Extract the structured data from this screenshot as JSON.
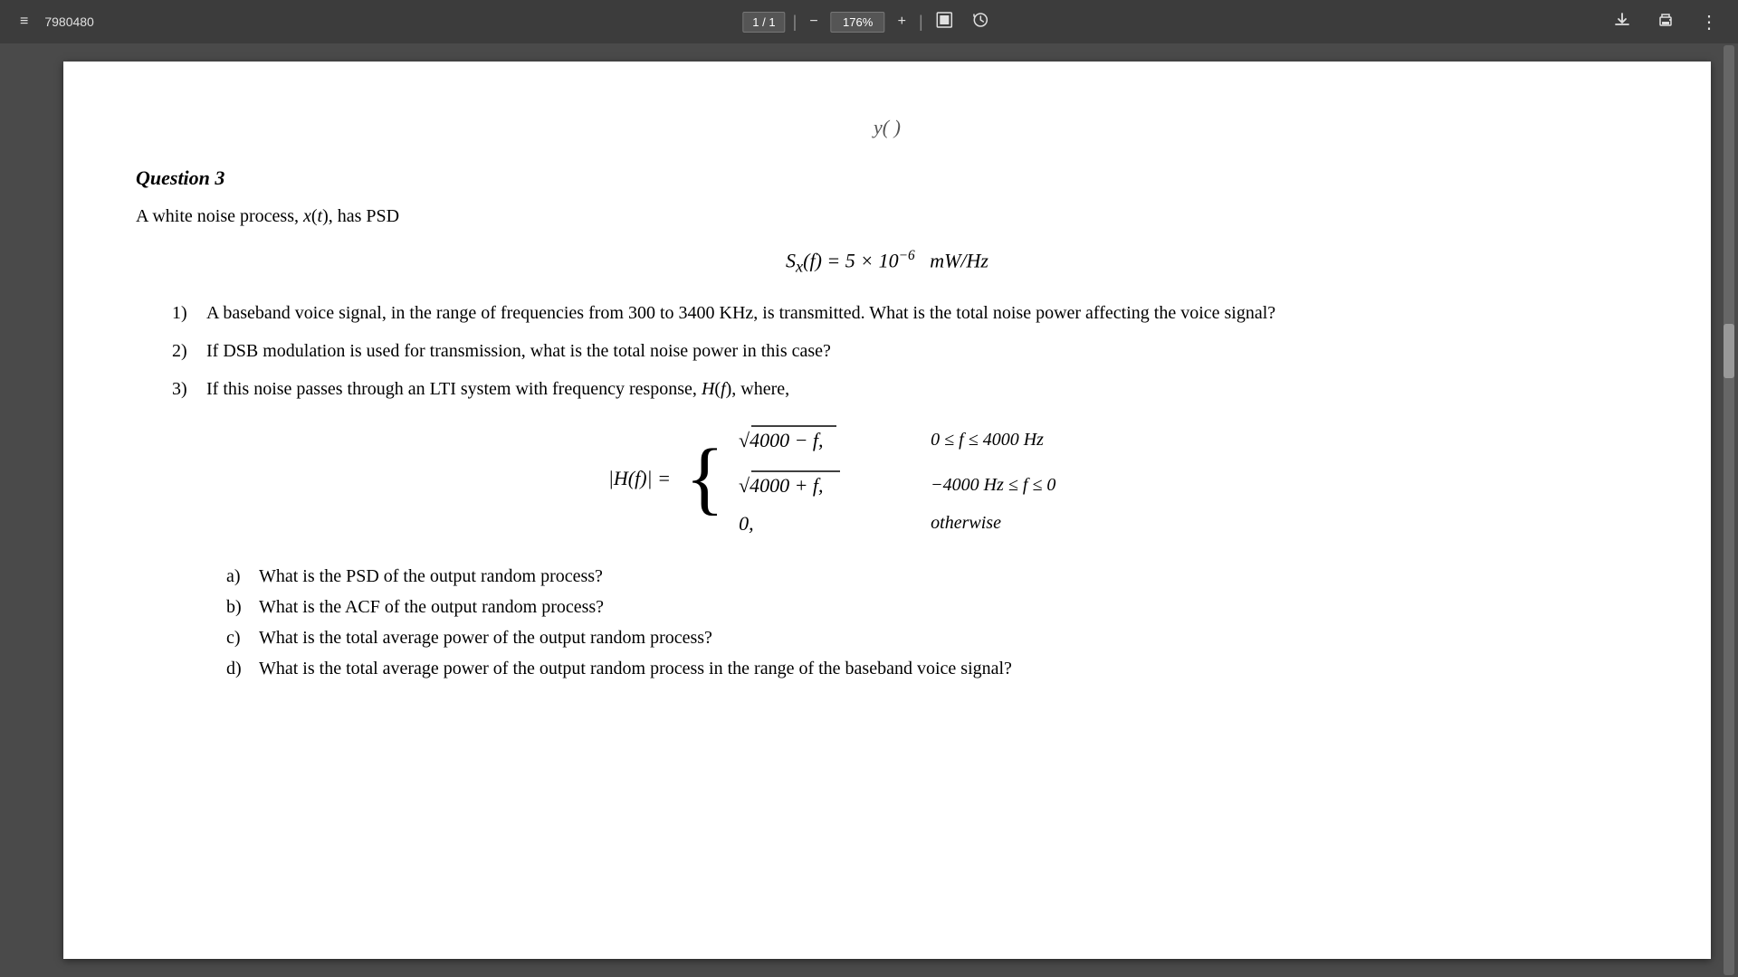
{
  "toolbar": {
    "menu_icon": "≡",
    "title": "7980480",
    "page_current": "1",
    "page_total": "1",
    "separator1": "|",
    "zoom_minus": "−",
    "zoom_level": "176%",
    "zoom_plus": "+",
    "separator2": "|",
    "fit_page_icon": "⬛",
    "history_icon": "◎",
    "download_icon": "⬇",
    "print_icon": "🖨",
    "more_icon": "⋮"
  },
  "page": {
    "partial_top": "y( )",
    "question_title": "Question 3",
    "intro": "A white noise process, x(t), has PSD",
    "psd_formula": "Sₓ(f) = 5 × 10⁻⁶  mW/Hz",
    "items": [
      {
        "num": "1)",
        "text": "A baseband voice signal, in the range of frequencies from 300 to 3400 KHz, is transmitted. What is the total noise power affecting the voice signal?"
      },
      {
        "num": "2)",
        "text": "If DSB modulation is used for transmission, what is the total noise power in this case?"
      },
      {
        "num": "3)",
        "text": "If this noise passes through an LTI system with frequency response, H(f), where,"
      }
    ],
    "piecewise": {
      "lhs": "|H(f)| =",
      "cases": [
        {
          "expr": "√(4000 − f),",
          "cond": "0 ≤ f ≤ 4000 Hz"
        },
        {
          "expr": "√(4000 + f),",
          "cond": "−4000 Hz ≤ f ≤ 0"
        },
        {
          "expr": "0,",
          "cond": "otherwise"
        }
      ]
    },
    "sub_items": [
      {
        "alpha": "a)",
        "text": "What is the PSD of the output random process?"
      },
      {
        "alpha": "b)",
        "text": "What is the ACF of the output random process?"
      },
      {
        "alpha": "c)",
        "text": "What is the total average power of the output random process?"
      },
      {
        "alpha": "d)",
        "text": "What is the total average power of the output random process in the range of the baseband voice signal?"
      }
    ]
  }
}
